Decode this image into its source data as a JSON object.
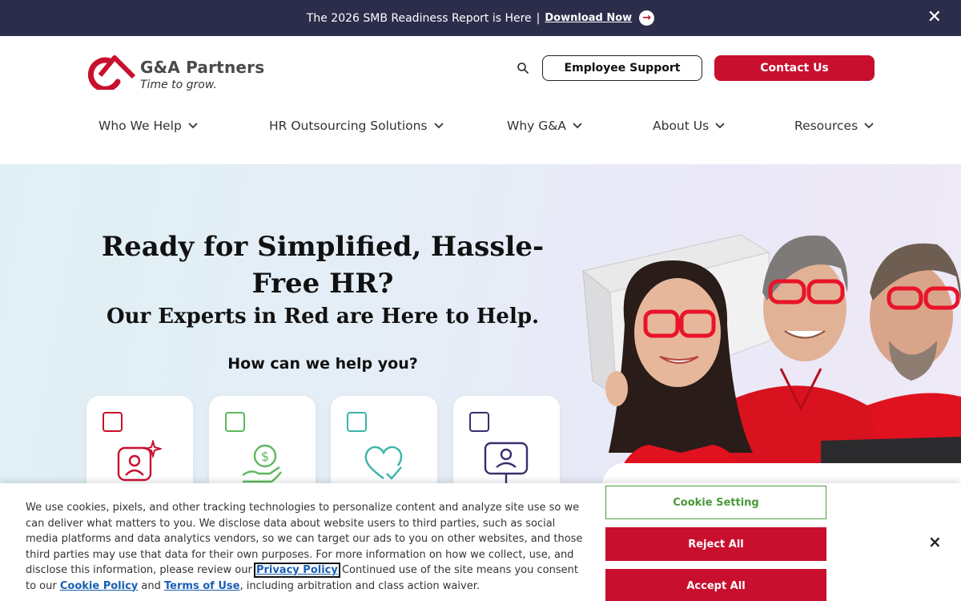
{
  "announcement": {
    "text": "The 2026 SMB Readiness Report is Here",
    "separator": "|",
    "link": "Download Now",
    "arrow": "→",
    "close": "✕"
  },
  "logo": {
    "name": "G&A Partners",
    "tagline": "Time to grow."
  },
  "header": {
    "employee_support": "Employee Support",
    "contact_us": "Contact Us"
  },
  "nav": {
    "items": [
      {
        "label": "Who We Help"
      },
      {
        "label": "HR Outsourcing Solutions"
      },
      {
        "label": "Why G&A"
      },
      {
        "label": "About Us"
      },
      {
        "label": "Resources"
      }
    ]
  },
  "hero": {
    "title": "Ready for Simplified, Hassle-Free HR?",
    "subtitle": "Our Experts in Red are Here to Help.",
    "question": "How can we help you?"
  },
  "cards": [
    {
      "icon": "person-sparkle-icon",
      "color": "#c8102e"
    },
    {
      "icon": "hand-dollar-icon",
      "color": "#5cb85c"
    },
    {
      "icon": "heart-check-icon",
      "color": "#3bb5a8"
    },
    {
      "icon": "monitor-user-icon",
      "color": "#3a2d6e"
    }
  ],
  "cookie": {
    "text_1": "We use cookies, pixels, and other tracking technologies to personalize content and analyze site use so we can deliver what matters to you. We disclose data about website users to third parties, such as social media platforms and data analytics vendors, so we can target our ads to you on other websites, and those third parties may use that data for their own purposes. For more information on how we collect, use, and disclose this information, please review our",
    "privacy_link": "Privacy Policy",
    "text_2": "Continued use of the site means you consent to our",
    "cookie_policy_link": "Cookie Policy",
    "and": "and",
    "terms_link": "Terms of Use",
    "text_3": ", including arbitration and class action waiver.",
    "setting_button": "Cookie Setting",
    "reject_button": "Reject All",
    "accept_button": "Accept All",
    "close": "×"
  },
  "colors": {
    "brand_red": "#c8102e",
    "navy": "#2b2d4b",
    "green": "#4a9a3a"
  }
}
